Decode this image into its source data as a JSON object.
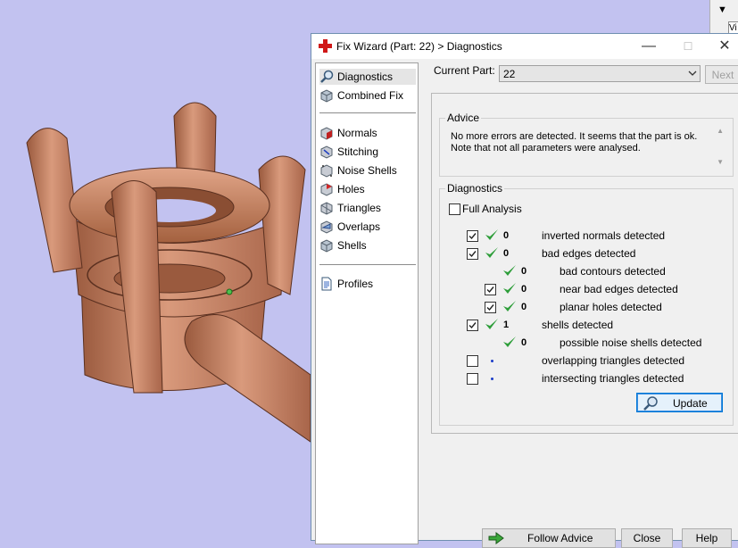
{
  "window": {
    "title": "Fix Wizard (Part: 22) > Diagnostics",
    "minimize": "—",
    "maximize": "☐",
    "close": "✕"
  },
  "corner": {
    "button_text": "Vi"
  },
  "nav": {
    "top_items": [
      {
        "label": "Diagnostics",
        "icon": "magnifier-icon",
        "selected": true
      },
      {
        "label": "Combined Fix",
        "icon": "cube-icon"
      }
    ],
    "fix_items": [
      {
        "label": "Normals",
        "icon": "normals-icon"
      },
      {
        "label": "Stitching",
        "icon": "stitching-icon"
      },
      {
        "label": "Noise Shells",
        "icon": "noise-shells-icon"
      },
      {
        "label": "Holes",
        "icon": "holes-icon"
      },
      {
        "label": "Triangles",
        "icon": "triangles-icon"
      },
      {
        "label": "Overlaps",
        "icon": "overlaps-icon"
      },
      {
        "label": "Shells",
        "icon": "shells-icon"
      }
    ],
    "profiles": {
      "label": "Profiles",
      "icon": "document-icon"
    }
  },
  "part": {
    "label": "Current Part:",
    "value": "22",
    "next_label": "Next"
  },
  "advice": {
    "title": "Advice",
    "line1": "No more errors are detected. It seems that the part is ok.",
    "line2": "Note that not all parameters were analysed."
  },
  "diagnostics": {
    "title": "Diagnostics",
    "full_analysis_label": "Full Analysis",
    "rows": [
      {
        "checkbox": true,
        "status": "ok",
        "count": "0",
        "label": "inverted normals detected",
        "indent": 0
      },
      {
        "checkbox": true,
        "status": "ok",
        "count": "0",
        "label": "bad edges detected",
        "indent": 0
      },
      {
        "checkbox": null,
        "status": "ok",
        "count": "0",
        "label": "bad contours detected",
        "indent": 1
      },
      {
        "checkbox": true,
        "status": "ok",
        "count": "0",
        "label": "near bad edges detected",
        "indent": 1
      },
      {
        "checkbox": true,
        "status": "ok",
        "count": "0",
        "label": "planar holes detected",
        "indent": 1
      },
      {
        "checkbox": true,
        "status": "ok",
        "count": "1",
        "label": "shells detected",
        "indent": 0
      },
      {
        "checkbox": null,
        "status": "ok",
        "count": "0",
        "label": "possible noise shells detected",
        "indent": 1
      },
      {
        "checkbox": false,
        "status": "none",
        "count": "",
        "label": "overlapping triangles detected",
        "indent": 0
      },
      {
        "checkbox": false,
        "status": "none",
        "count": "",
        "label": "intersecting triangles detected",
        "indent": 0
      }
    ],
    "update_label": "Update"
  },
  "footer": {
    "follow_advice": "Follow Advice",
    "close": "Close",
    "help": "Help"
  },
  "colors": {
    "viewport_bg": "#c2c2f0",
    "model_copper": "#c8876a",
    "check_green": "#2e9e3a",
    "accent_blue": "#0078d7"
  }
}
